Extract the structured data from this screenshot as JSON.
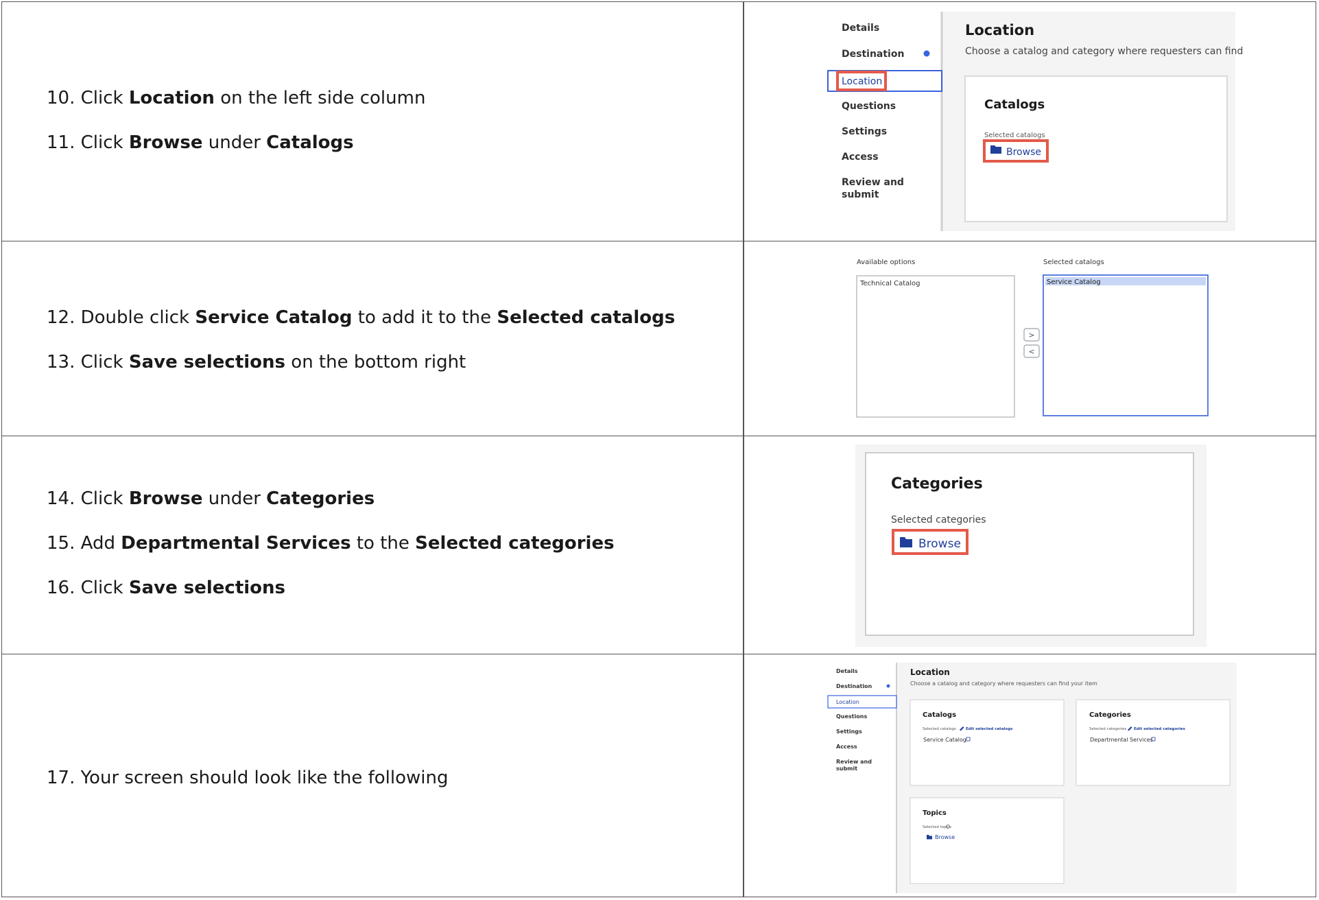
{
  "rows": [
    {
      "steps": [
        {
          "num": "10.",
          "parts": [
            "Click ",
            "Location",
            " on the left side column"
          ]
        },
        {
          "num": "11.",
          "parts": [
            "Click ",
            "Browse",
            " under ",
            "Catalogs"
          ]
        }
      ],
      "screenshot": {
        "nav": [
          "Details",
          "Destination",
          "Location",
          "Questions",
          "Settings",
          "Access",
          "Review and submit"
        ],
        "title": "Location",
        "subtitle": "Choose a catalog and category where requesters can find yc",
        "card_title": "Catalogs",
        "field_label": "Selected catalogs",
        "button": "Browse"
      }
    },
    {
      "steps": [
        {
          "num": "12.",
          "parts": [
            "Double click ",
            "Service Catalog",
            " to add it to the ",
            "Selected catalogs"
          ]
        },
        {
          "num": "13.",
          "parts": [
            "Click ",
            "Save selections",
            " on the bottom right"
          ]
        }
      ],
      "screenshot": {
        "available_label": "Available options",
        "available_items": [
          "Technical Catalog"
        ],
        "selected_label": "Selected catalogs",
        "selected_items": [
          "Service Catalog"
        ],
        "move_right": ">",
        "move_left": "<"
      }
    },
    {
      "steps": [
        {
          "num": "14.",
          "parts": [
            "Click ",
            "Browse",
            " under ",
            "Categories"
          ]
        },
        {
          "num": "15.",
          "parts": [
            "Add ",
            "Departmental Services",
            " to the ",
            "Selected categories"
          ]
        },
        {
          "num": "16.",
          "parts": [
            "Click ",
            "Save selections",
            ""
          ]
        }
      ],
      "screenshot": {
        "card_title": "Categories",
        "field_label": "Selected categories",
        "button": "Browse"
      }
    },
    {
      "steps": [
        {
          "num": "17.",
          "parts": [
            "Your screen should look like the following"
          ]
        }
      ],
      "screenshot": {
        "nav": [
          "Details",
          "Destination",
          "Location",
          "Questions",
          "Settings",
          "Access",
          "Review and submit"
        ],
        "title": "Location",
        "subtitle": "Choose a catalog and category where requesters can find your item",
        "catalogs": {
          "title": "Catalogs",
          "label": "Selected catalogs",
          "edit": "Edit selected catalogs",
          "value": "Service Catalog"
        },
        "categories": {
          "title": "Categories",
          "label": "Selected categories",
          "edit": "Edit selected categories",
          "value": "Departmental Services"
        },
        "topics": {
          "title": "Topics",
          "label": "Selected topics",
          "button": "Browse"
        }
      }
    }
  ],
  "colors": {
    "highlight": "#e35a4a",
    "link": "#1f3f9a",
    "indicator": "#3b63e0",
    "grid": "#555555"
  },
  "icons": [
    "folder-icon",
    "pencil-icon",
    "external-link-icon",
    "info-icon",
    "chevron-right-icon",
    "chevron-left-icon"
  ]
}
